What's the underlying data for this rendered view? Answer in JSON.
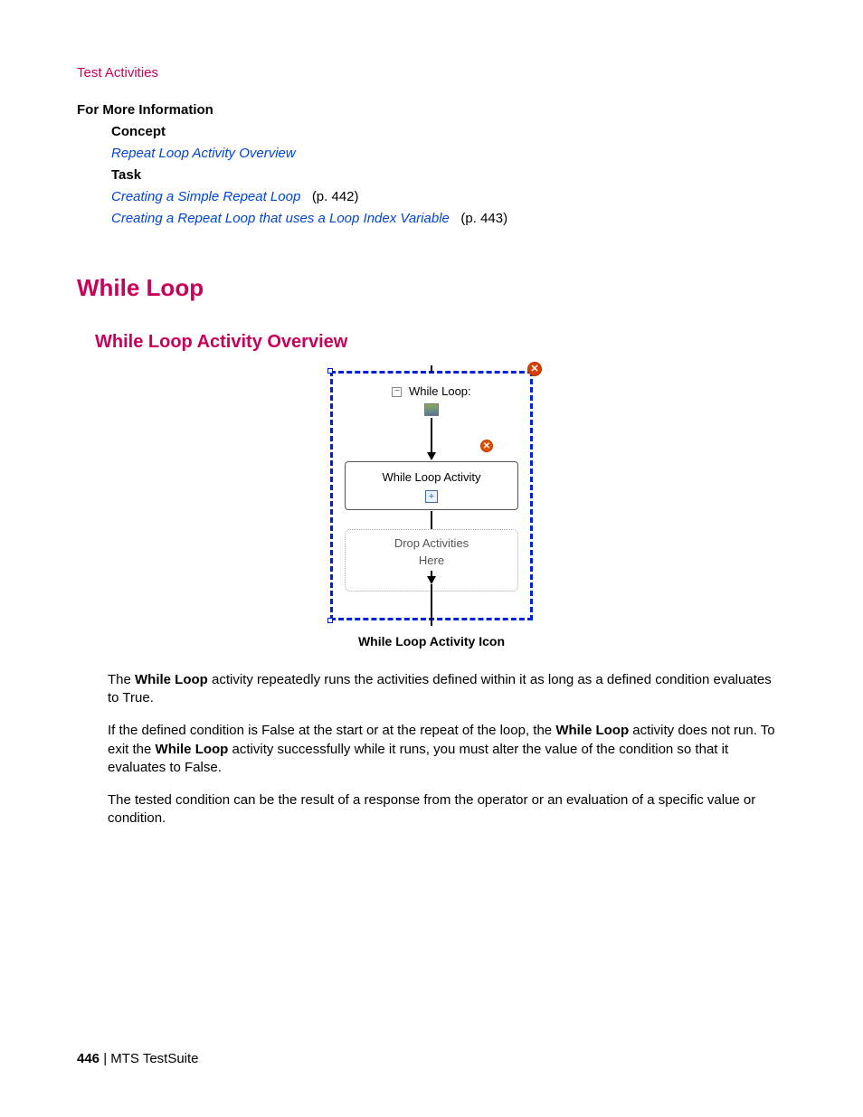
{
  "header_link": "Test Activities",
  "fmi": {
    "heading": "For More Information",
    "concept_label": "Concept",
    "concept_link": "Repeat Loop Activity Overview",
    "task_label": "Task",
    "task_links": [
      {
        "text": "Creating a Simple Repeat Loop",
        "page": "(p. 442)"
      },
      {
        "text": "Creating a Repeat Loop that uses a Loop Index Variable",
        "page": "(p. 443)"
      }
    ]
  },
  "h1": "While Loop",
  "h2": "While Loop Activity Overview",
  "diagram": {
    "title_prefix": "While Loop:",
    "inner_label": "While Loop Activity",
    "drop_line1": "Drop Activities",
    "drop_line2": "Here",
    "close_glyph": "✕",
    "warn_glyph": "✕",
    "minus_glyph": "−",
    "plus_glyph": "+"
  },
  "caption": "While Loop Activity Icon",
  "para1_a": "The ",
  "para1_b": "While Loop",
  "para1_c": " activity repeatedly runs the activities defined within it as long as a defined condition evaluates to True.",
  "para2_a": "If the defined condition is False at the start or at the repeat of the loop, the ",
  "para2_b": "While Loop",
  "para2_c": " activity does not run. To exit the ",
  "para2_d": "While Loop",
  "para2_e": " activity successfully while it runs, you must alter the value of the condition so that it evaluates to False.",
  "para3": "The tested condition can be the result of a response from the operator or an evaluation of a specific value or condition.",
  "footer_page": "446",
  "footer_sep": " | ",
  "footer_product": "MTS TestSuite"
}
